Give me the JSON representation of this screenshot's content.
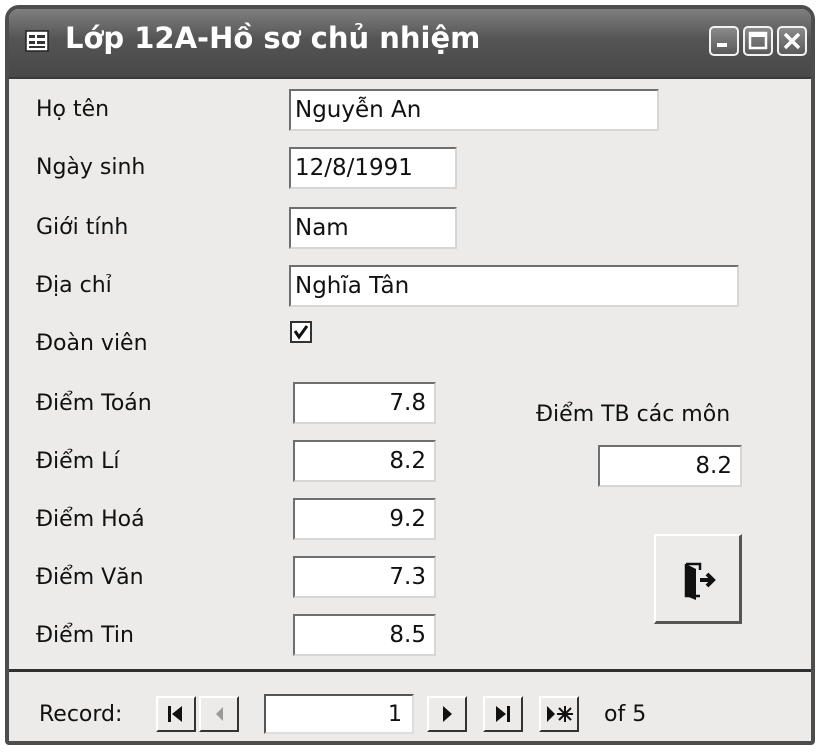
{
  "window": {
    "title": "Lớp 12A-Hồ sơ chủ nhiệm",
    "controls": [
      "minimize-icon",
      "maximize-icon",
      "close-icon"
    ]
  },
  "form": {
    "ho_ten": {
      "label": "Họ tên",
      "value": "Nguyễn An"
    },
    "ngay_sinh": {
      "label": "Ngày sinh",
      "value": "12/8/1991"
    },
    "gioi_tinh": {
      "label": "Giới tính",
      "value": "Nam"
    },
    "dia_chi": {
      "label": "Địa chỉ",
      "value": "Nghĩa Tân"
    },
    "doan_vien": {
      "label": "Đoàn viên",
      "checked": true
    },
    "diem_toan": {
      "label": "Điểm Toán",
      "value": "7.8"
    },
    "diem_li": {
      "label": "Điểm Lí",
      "value": "8.2"
    },
    "diem_hoa": {
      "label": "Điểm Hoá",
      "value": "9.2"
    },
    "diem_van": {
      "label": "Điểm Văn",
      "value": "7.3"
    },
    "diem_tin": {
      "label": "Điểm Tin",
      "value": "8.5"
    },
    "diem_tb": {
      "label": "Điểm TB các môn",
      "value": "8.2"
    },
    "exit_button": {
      "icon": "exit-door-icon"
    }
  },
  "navigation": {
    "record_label": "Record:",
    "current": "1",
    "of_label": "of 5",
    "buttons": [
      "first-record-icon",
      "previous-record-icon",
      "next-record-icon",
      "last-record-icon",
      "new-record-icon"
    ]
  }
}
